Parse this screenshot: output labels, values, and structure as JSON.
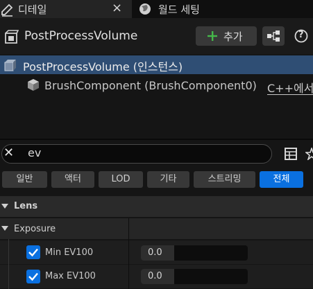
{
  "tabs": [
    {
      "label": "디테일",
      "close_label": "×"
    },
    {
      "label": "월드 세팅"
    }
  ],
  "header": {
    "title": "PostProcessVolume",
    "add_label": "추가",
    "help_label": "?"
  },
  "tree": {
    "selected": "PostProcessVolume (인스턴스)",
    "child": {
      "label": "BrushComponent (BrushComponent0)",
      "source": "C++에서"
    }
  },
  "search": {
    "value": "ev",
    "clear_label": "✕"
  },
  "filters": [
    "일반",
    "액터",
    "LOD",
    "기타",
    "스트리밍",
    "전체"
  ],
  "active_filter": "전체",
  "categories": [
    {
      "label": "Lens"
    },
    {
      "label": "Exposure"
    }
  ],
  "properties": [
    {
      "label": "Min EV100",
      "value": "0.0",
      "checked": true
    },
    {
      "label": "Max EV100",
      "value": "0.0",
      "checked": true
    }
  ],
  "colors": {
    "accent": "#0a70e0",
    "selection": "#2f4e74",
    "background": "#151515"
  }
}
